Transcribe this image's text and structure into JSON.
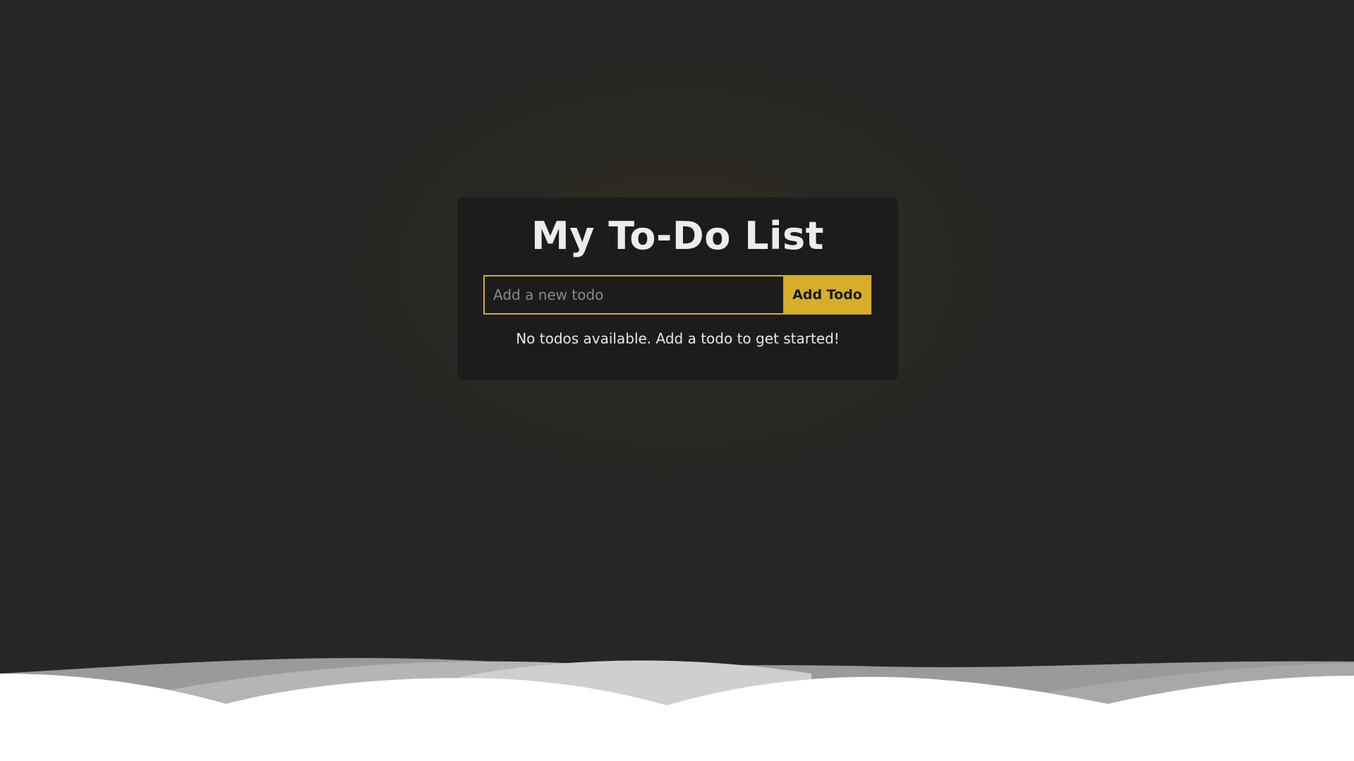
{
  "app": {
    "title": "My To-Do List"
  },
  "form": {
    "input_value": "",
    "input_placeholder": "Add a new todo",
    "add_button_label": "Add Todo"
  },
  "todos": {
    "items": [],
    "empty_message": "No todos available. Add a todo to get started!"
  },
  "colors": {
    "background": "#262626",
    "card": "#1c1c1c",
    "accent": "#d6ae28",
    "text": "#ececec"
  }
}
